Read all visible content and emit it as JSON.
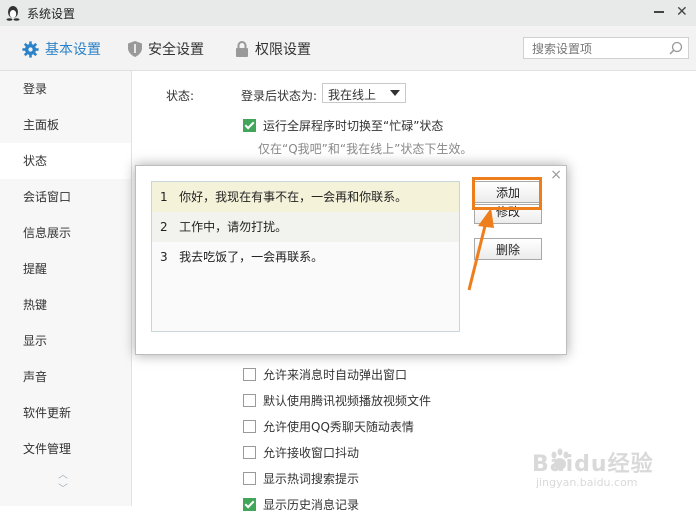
{
  "window": {
    "title": "系统设置",
    "close_glyph": "✕"
  },
  "topnav": {
    "tabs": [
      {
        "label": "基本设置",
        "icon": "gear-icon",
        "active": true
      },
      {
        "label": "安全设置",
        "icon": "shield-icon",
        "active": false
      },
      {
        "label": "权限设置",
        "icon": "lock-icon",
        "active": false
      }
    ],
    "search_placeholder": "搜索设置项"
  },
  "sidebar": {
    "items": [
      "登录",
      "主面板",
      "状态",
      "会话窗口",
      "信息展示",
      "提醒",
      "热键",
      "显示",
      "声音",
      "软件更新",
      "文件管理"
    ],
    "active_index": 2,
    "up_glyph": "︿",
    "down_glyph": "﹀"
  },
  "status_section": {
    "label": "状态:",
    "login_status_label": "登录后状态为:",
    "login_status_value": "我在线上",
    "fullscreen_option": "运行全屏程序时切换至“忙碌”状态",
    "fullscreen_checked": true,
    "hint": "仅在“Q我吧”和“我在线上”状态下生效。"
  },
  "dialog": {
    "close_glyph": "×",
    "messages": [
      {
        "no": "1",
        "text": "你好，我现在有事不在，一会再和你联系。"
      },
      {
        "no": "2",
        "text": "工作中，请勿打扰。"
      },
      {
        "no": "3",
        "text": "我去吃饭了，一会再联系。"
      }
    ],
    "buttons": {
      "add": "添加",
      "edit": "修改",
      "delete": "删除"
    },
    "highlight_color": "#ee7d1b"
  },
  "options": [
    {
      "label": "允许来消息时自动弹出窗口",
      "checked": false
    },
    {
      "label": "默认使用腾讯视频播放视频文件",
      "checked": false
    },
    {
      "label": "允许使用QQ秀聊天随动表情",
      "checked": false
    },
    {
      "label": "允许接收窗口抖动",
      "checked": false
    },
    {
      "label": "显示热词搜索提示",
      "checked": false
    },
    {
      "label": "显示历史消息记录",
      "checked": true
    }
  ],
  "watermark": {
    "brand": "Baidu经验",
    "url": "jingyan.baidu.com"
  },
  "colors": {
    "accent": "#2c82c9",
    "check": "#41a65a",
    "annotation": "#ee7d1b"
  }
}
